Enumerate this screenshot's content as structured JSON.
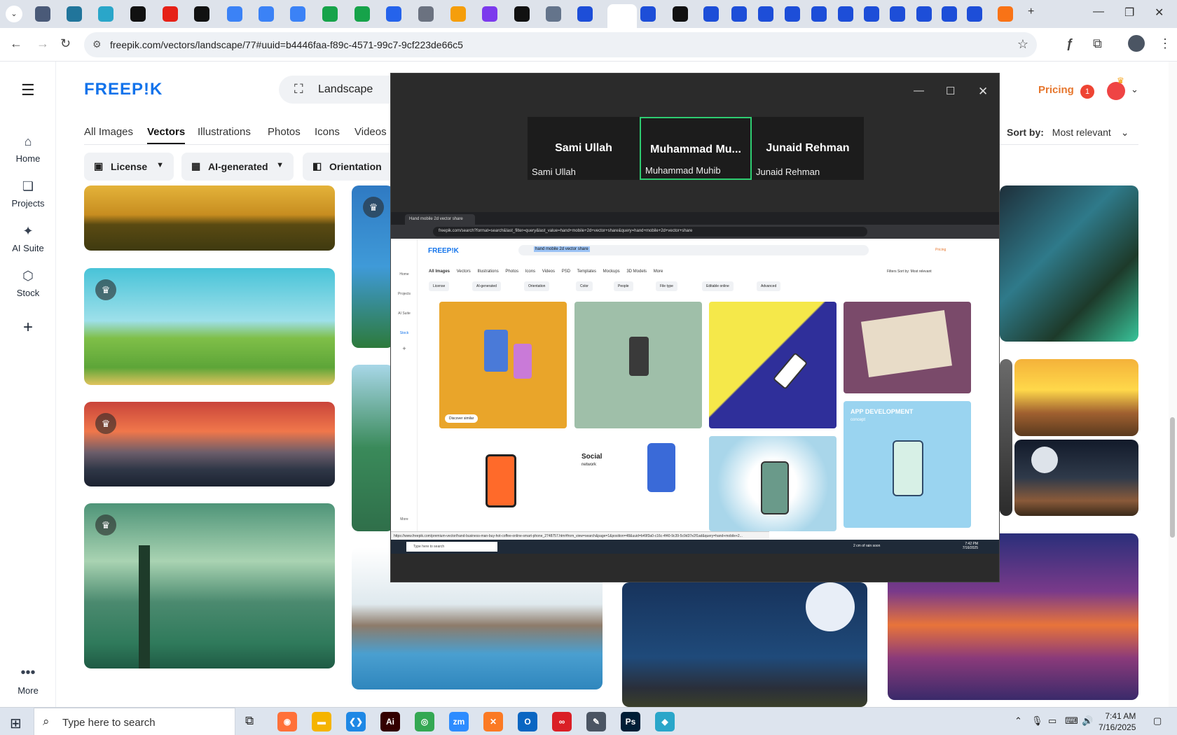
{
  "browser": {
    "url": "freepik.com/vectors/landscape/77#uuid=b4446faa-f89c-4571-99c7-9cf223de66c5",
    "tab_icons": [
      {
        "icon": "globe-icon",
        "color": "#4a5a78"
      },
      {
        "icon": "wordpress-icon",
        "color": "#21759b"
      },
      {
        "icon": "app-icon",
        "color": "#2aa6c9"
      },
      {
        "icon": "openai-icon",
        "color": "#111111"
      },
      {
        "icon": "youtube-icon",
        "color": "#e62117"
      },
      {
        "icon": "bolt-icon",
        "color": "#111111"
      },
      {
        "icon": "docs-icon",
        "color": "#3b82f6"
      },
      {
        "icon": "docs-icon",
        "color": "#3b82f6"
      },
      {
        "icon": "docs-icon",
        "color": "#3b82f6"
      },
      {
        "icon": "sheets-icon",
        "color": "#16a34a"
      },
      {
        "icon": "sheets-icon",
        "color": "#16a34a"
      },
      {
        "icon": "translate-icon",
        "color": "#2563eb"
      },
      {
        "icon": "globe-icon",
        "color": "#6b7280"
      },
      {
        "icon": "bird-icon",
        "color": "#f59e0b"
      },
      {
        "icon": "braces-icon",
        "color": "#7c3aed"
      },
      {
        "icon": "ai-icon",
        "color": "#111111"
      },
      {
        "icon": "tool-icon",
        "color": "#64748b"
      },
      {
        "icon": "freepik-icon",
        "color": "#1d4ed8"
      },
      {
        "icon": "freepik-icon",
        "color": "#1d4ed8"
      },
      {
        "icon": "freepik-icon",
        "color": "#1d4ed8"
      },
      {
        "icon": "medium-icon",
        "color": "#111111"
      },
      {
        "icon": "freepik-icon",
        "color": "#1d4ed8"
      },
      {
        "icon": "freepik-icon",
        "color": "#1d4ed8"
      },
      {
        "icon": "freepik-icon",
        "color": "#1d4ed8"
      },
      {
        "icon": "freepik-icon",
        "color": "#1d4ed8"
      },
      {
        "icon": "freepik-icon",
        "color": "#1d4ed8"
      },
      {
        "icon": "freepik-icon",
        "color": "#1d4ed8"
      },
      {
        "icon": "freepik-icon",
        "color": "#1d4ed8"
      },
      {
        "icon": "freepik-icon",
        "color": "#1d4ed8"
      },
      {
        "icon": "freepik-icon",
        "color": "#1d4ed8"
      },
      {
        "icon": "freepik-icon",
        "color": "#1d4ed8"
      },
      {
        "icon": "freepik-icon",
        "color": "#1d4ed8"
      },
      {
        "icon": "hand-icon",
        "color": "#f97316"
      }
    ]
  },
  "freepik": {
    "brand_color": "#1273eb",
    "logo": "FREEP!K",
    "search_value": "Landscape",
    "pricing": "Pricing",
    "notification_count": "1",
    "sidebar": [
      {
        "label": "Home",
        "icon": "home-icon"
      },
      {
        "label": "Projects",
        "icon": "folder-icon"
      },
      {
        "label": "AI Suite",
        "icon": "sparkle-icon"
      },
      {
        "label": "Stock",
        "icon": "stock-icon"
      },
      {
        "label": "",
        "icon": "plus-icon"
      }
    ],
    "more_label": "More",
    "tabs": [
      "All Images",
      "Vectors",
      "Illustrations",
      "Photos",
      "Icons",
      "Videos"
    ],
    "active_tab": "Vectors",
    "sort_label": "Sort by:",
    "sort_value": "Most relevant",
    "filters": [
      "License",
      "AI-generated",
      "Orientation"
    ]
  },
  "zoom": {
    "participants": [
      {
        "tile_name": "Sami Ullah",
        "label": "Sami Ullah",
        "speaking": false
      },
      {
        "tile_name": "Muhammad  Mu...",
        "label": "Muhammad Muhib",
        "speaking": true
      },
      {
        "tile_name": "Junaid Rehman",
        "label": "Junaid Rehman",
        "speaking": false
      }
    ],
    "shared": {
      "tab_title": "Hand mobile 2d vector share",
      "url": "freepik.com/search?format=search&last_filter=query&last_value=hand+mobile+2d+vector+share&query=hand+mobile+2d+vector+share",
      "logo": "FREEP!K",
      "search": "hand mobile 2d vector share",
      "pricing": "Pricing",
      "sidebar": [
        "Home",
        "Projects",
        "AI Suite",
        "Stock",
        "+",
        "More"
      ],
      "tabs": [
        "All Images",
        "Vectors",
        "Illustrations",
        "Photos",
        "Icons",
        "Videos",
        "PSD",
        "Templates",
        "Mockups",
        "3D Models",
        "More"
      ],
      "filters": [
        "License",
        "AI-generated",
        "Orientation",
        "Color",
        "People",
        "File type",
        "Editable online",
        "Advanced"
      ],
      "right_controls": "Filters   Sort by: Most relevant",
      "discover": "Discover similar",
      "social_title": "Social",
      "social_sub": "network",
      "app_dev": "APP DEVELOPMENT",
      "app_dev_sub": "concept",
      "status_url": "https://www.freepik.com/premium-vector/hand-business-man-buy-hot-coffee-online-smart-phone_2748757.htm#from_view=search&page=1&position=48&uuid=b49f3a0-c16c-4f40-9c39-5c9d37e2f1ad&query=hand+mobile+2...",
      "taskbar_search": "Type here to search",
      "weather": "2 cm of rain soon",
      "time": "7:42 PM",
      "date": "7/16/2025"
    }
  },
  "taskbar": {
    "search_placeholder": "Type here to search",
    "time": "7:41 AM",
    "date": "7/16/2025",
    "apps": [
      {
        "icon": "firefox-icon",
        "color": "#ff7139",
        "glyph": "◉"
      },
      {
        "icon": "file-explorer-icon",
        "color": "#f5b400",
        "glyph": "▬"
      },
      {
        "icon": "vscode-icon",
        "color": "#1e88e5",
        "glyph": "❮❯"
      },
      {
        "icon": "illustrator-icon",
        "color": "#330000",
        "glyph": "Ai"
      },
      {
        "icon": "chrome-icon",
        "color": "#34a853",
        "glyph": "◎"
      },
      {
        "icon": "zoom-icon",
        "color": "#2d8cff",
        "glyph": "zm"
      },
      {
        "icon": "xampp-icon",
        "color": "#fb7a24",
        "glyph": "✕"
      },
      {
        "icon": "outlook-icon",
        "color": "#0a66c2",
        "glyph": "O"
      },
      {
        "icon": "creative-cloud-icon",
        "color": "#da1f26",
        "glyph": "∞"
      },
      {
        "icon": "pen-tool-icon",
        "color": "#4b5563",
        "glyph": "✎"
      },
      {
        "icon": "photoshop-icon",
        "color": "#001e36",
        "glyph": "Ps"
      },
      {
        "icon": "app-icon",
        "color": "#2aa6c9",
        "glyph": "◆"
      }
    ]
  }
}
